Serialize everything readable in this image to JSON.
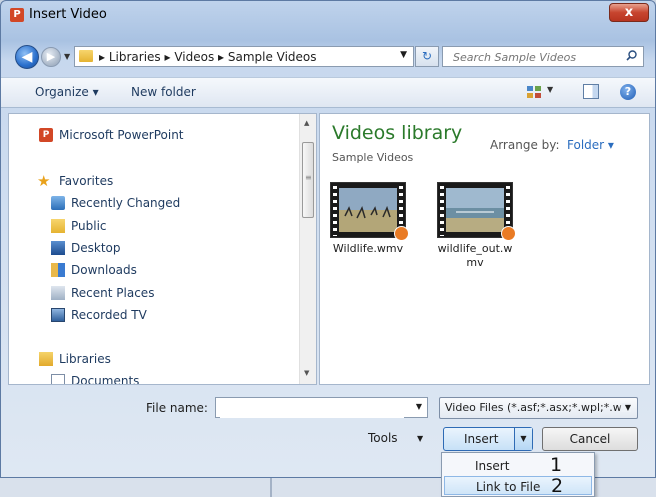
{
  "window": {
    "title": "Insert Video",
    "app_icon_letter": "P",
    "close_glyph": "x"
  },
  "nav": {
    "back_glyph": "◀",
    "breadcrumb": "▸ Libraries ▸ Videos ▸ Sample Videos",
    "search_placeholder": "Search Sample Videos"
  },
  "toolbar": {
    "organize": "Organize ▾",
    "new_folder": "New folder",
    "help_glyph": "?"
  },
  "sidebar": {
    "items": [
      {
        "label": "Microsoft PowerPoint",
        "icon": "powerpoint-icon"
      },
      {
        "label": "Favorites",
        "icon": "star-icon"
      },
      {
        "label": "Recently Changed",
        "icon": "recent-icon"
      },
      {
        "label": "Public",
        "icon": "folder-icon"
      },
      {
        "label": "Desktop",
        "icon": "desktop-icon"
      },
      {
        "label": "Downloads",
        "icon": "downloads-icon"
      },
      {
        "label": "Recent Places",
        "icon": "recent-places-icon"
      },
      {
        "label": "Recorded TV",
        "icon": "tv-icon"
      },
      {
        "label": "Libraries",
        "icon": "libraries-icon"
      },
      {
        "label": "Documents",
        "icon": "documents-icon"
      }
    ]
  },
  "main": {
    "title": "Videos library",
    "subtitle": "Sample Videos",
    "arrange_label": "Arrange by:",
    "arrange_value": "Folder ▾",
    "files": [
      {
        "name": "Wildlife.wmv"
      },
      {
        "name": "wildlife_out.wmv"
      }
    ]
  },
  "footer": {
    "file_name_label": "File name:",
    "file_name_value": "",
    "file_type": "Video Files (*.asf;*.asx;*.wpl;*.w",
    "tools": "Tools",
    "insert": "Insert",
    "cancel": "Cancel"
  },
  "insert_menu": {
    "items": [
      {
        "label": "Insert",
        "callout": "1"
      },
      {
        "label": "Link to File",
        "callout": "2"
      }
    ]
  },
  "colors": {
    "library_title": "#2b7a2b",
    "accent": "#2b6dbf",
    "close": "#c7452f"
  }
}
